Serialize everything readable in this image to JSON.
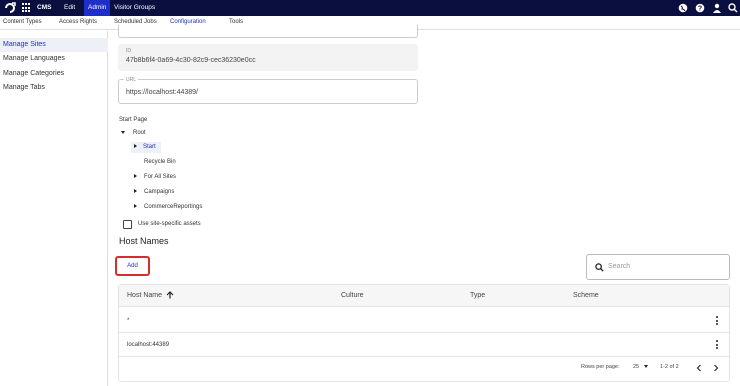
{
  "topbar": {
    "product": "CMS",
    "items": [
      "Edit",
      "Admin",
      "Visitor Groups"
    ]
  },
  "subnav": {
    "tabs": [
      "Content Types",
      "Access Rights",
      "Scheduled Jobs",
      "Configuration",
      "Tools"
    ],
    "active": "Configuration"
  },
  "sidebar": {
    "items": [
      "Manage Sites",
      "Manage Languages",
      "Manage Categories",
      "Manage Tabs"
    ],
    "active": "Manage Sites"
  },
  "form": {
    "id_label": "ID",
    "id_value": "47b8b6f4-0a69-4c30-82c9-cec36230e0cc",
    "url_label": "URL",
    "url_value": "https://localhost:44389/"
  },
  "start_page": {
    "label": "Start Page",
    "tree": [
      "Root",
      "Start",
      "Recycle Bin",
      "For All Sites",
      "Campaigns",
      "CommerceReportings"
    ]
  },
  "checkbox_label": "Use site-specific assets",
  "host_names": {
    "title": "Host Names",
    "add_label": "Add",
    "search_placeholder": "Search",
    "columns": [
      "Host Name",
      "Culture",
      "Type",
      "Scheme"
    ],
    "rows": [
      {
        "host": "*",
        "culture": "",
        "type": "",
        "scheme": ""
      },
      {
        "host": "localhost:44389",
        "culture": "",
        "type": "",
        "scheme": ""
      }
    ],
    "rows_per_page_label": "Rows per page:",
    "rows_per_page_value": "25",
    "range_label": "1-2 of 2"
  },
  "colors": {
    "topbar_bg": "#0b0f3f",
    "accent": "#1e2fc9",
    "highlight_border": "#d32f2f"
  }
}
